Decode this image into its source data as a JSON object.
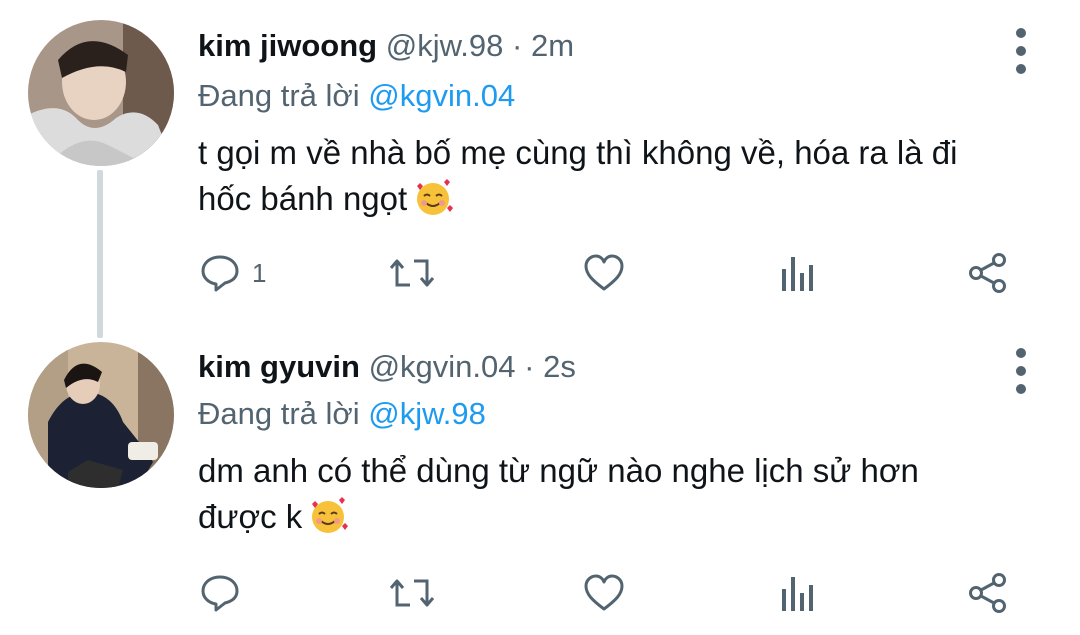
{
  "tweets": [
    {
      "display_name": "kim jiwoong",
      "handle": "@kjw.98",
      "separator": "·",
      "time": "2m",
      "replying_prefix": "Đang trả lời",
      "replying_to": "@kgvin.04",
      "text_line1": "t gọi m về nhà bố mẹ cùng thì không về, hóa ra là đi",
      "text_line2": "hốc bánh ngọt",
      "emoji": "smiling-face-with-hearts",
      "reply_count": "1"
    },
    {
      "display_name": "kim gyuvin",
      "handle": "@kgvin.04",
      "separator": "·",
      "time": "2s",
      "replying_prefix": "Đang trả lời",
      "replying_to": "@kjw.98",
      "text_line1": "dm anh có thể dùng từ ngữ nào nghe lịch sử hơn",
      "text_line2": "được k",
      "emoji": "smiling-face-with-hearts",
      "reply_count": ""
    }
  ],
  "colors": {
    "link": "#1d9bf0",
    "secondary_text": "#536471",
    "icon": "#536471",
    "thread_line": "#cfd9de"
  },
  "icons": [
    "reply-icon",
    "retweet-icon",
    "like-icon",
    "analytics-icon",
    "share-icon",
    "more-options-icon"
  ]
}
